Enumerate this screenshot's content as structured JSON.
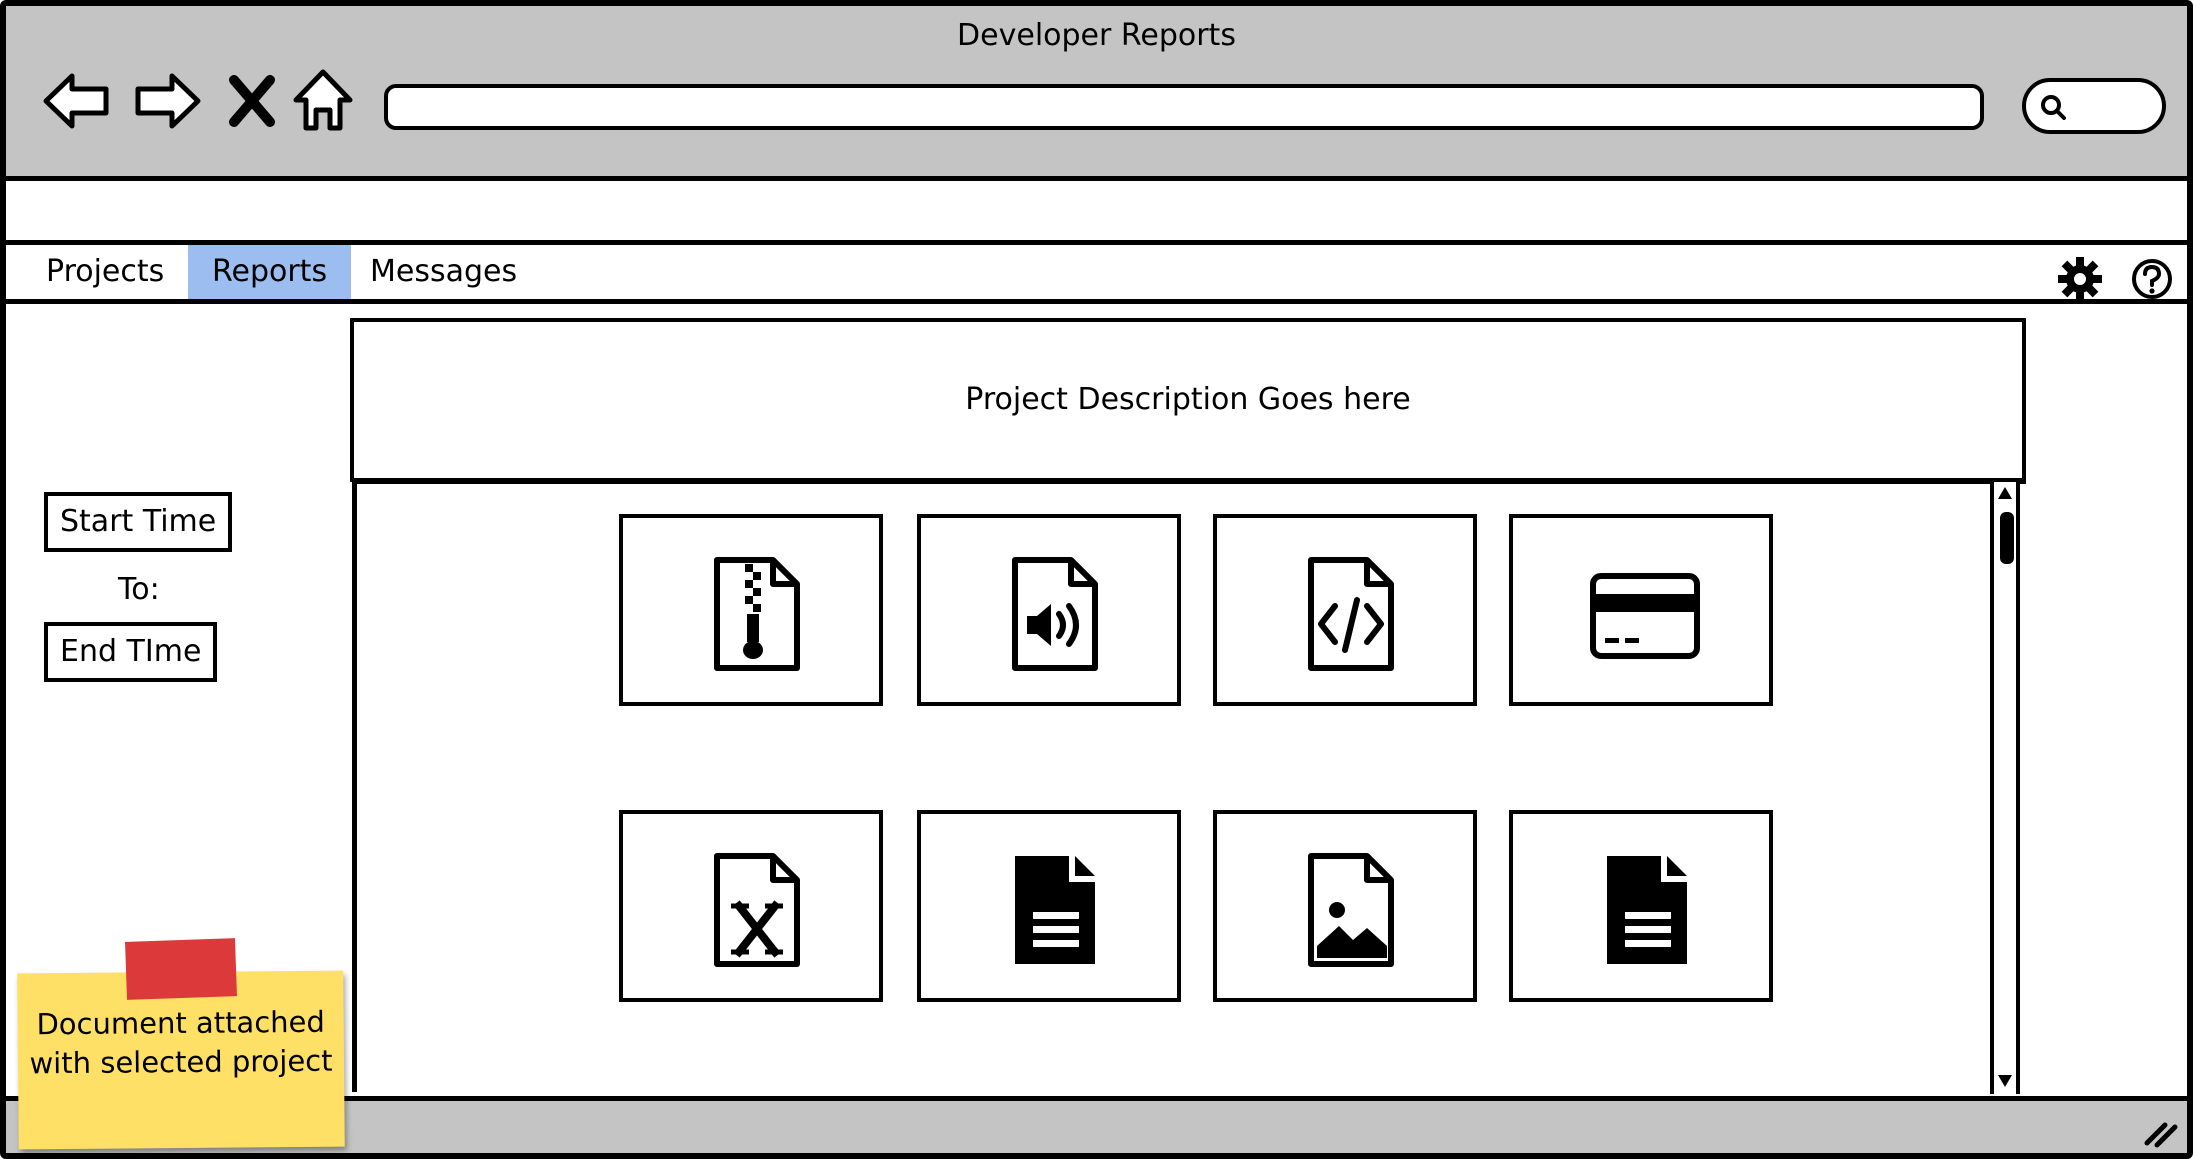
{
  "window": {
    "title": "Developer Reports"
  },
  "browser": {
    "nav": [
      "back-icon",
      "forward-icon",
      "close-icon",
      "home-icon"
    ],
    "address": "",
    "search": {
      "icon": "search-icon",
      "value": ""
    }
  },
  "tabs": [
    {
      "label": "Projects",
      "active": false
    },
    {
      "label": "Reports",
      "active": true
    },
    {
      "label": "Messages",
      "active": false
    }
  ],
  "toolbar_icons": [
    "gear-icon",
    "help-icon"
  ],
  "filters": {
    "start_label": "Start Time",
    "to_label": "To:",
    "end_label": "End TIme"
  },
  "description": "Project Description Goes here",
  "documents": [
    {
      "icon": "zip-file-icon"
    },
    {
      "icon": "audio-file-icon"
    },
    {
      "icon": "code-file-icon"
    },
    {
      "icon": "credit-card-icon"
    },
    {
      "icon": "excel-file-icon"
    },
    {
      "icon": "text-document-icon"
    },
    {
      "icon": "image-file-icon"
    },
    {
      "icon": "text-document-icon"
    }
  ],
  "note": {
    "text": "Document attached with selected project",
    "color": "#ffe066",
    "tape_color": "#dc3a3a"
  },
  "colors": {
    "chrome": "#c4c4c4",
    "active_tab": "#9bbdf0"
  }
}
